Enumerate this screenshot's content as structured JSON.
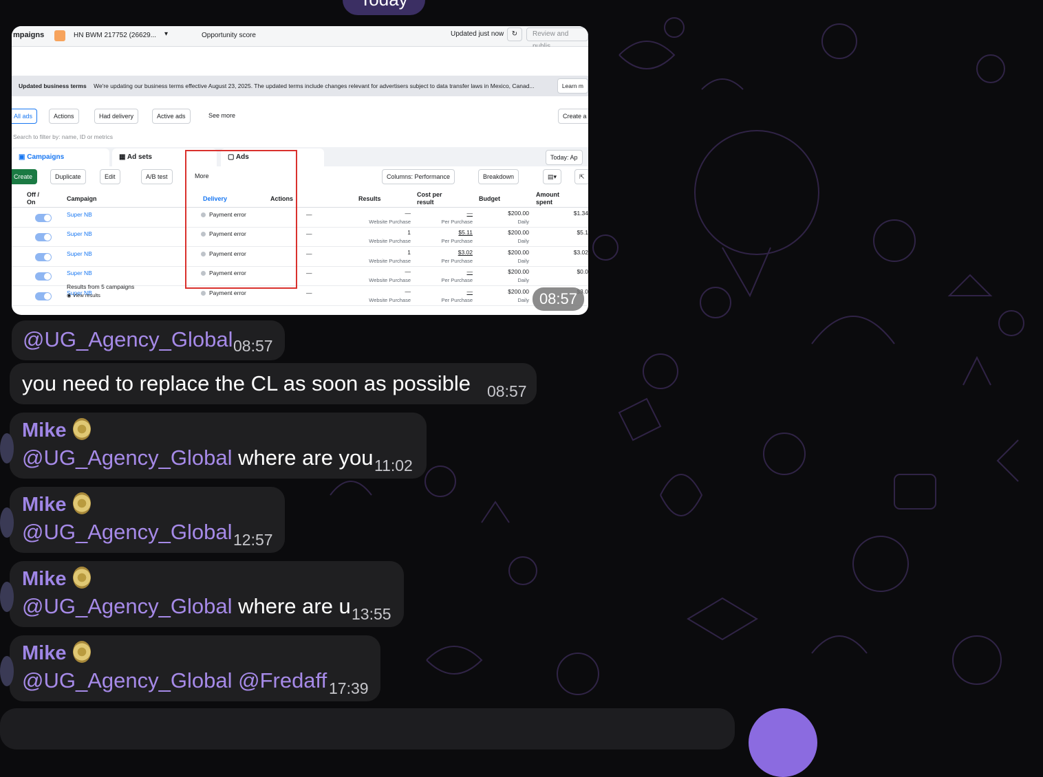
{
  "day_separator": "Today",
  "screenshot": {
    "top_bar": {
      "title_fragment": "mpaigns",
      "account": "HN BWM 217752 (26629...",
      "opportunity": "Opportunity score",
      "updated": "Updated just now",
      "review": "Review and publis"
    },
    "banner": {
      "label": "Updated business terms",
      "text": "We're updating our business terms effective August 23, 2025. The updated terms include changes relevant for advertisers subject to data transfer laws in Mexico, Canad...",
      "learn": "Learn m"
    },
    "filter_tabs": [
      "All ads",
      "Actions",
      "Had delivery",
      "Active ads",
      "See more"
    ],
    "create_all": "Create a",
    "search_placeholder": "Search to filter by: name, ID or metrics",
    "levels": [
      "Campaigns",
      "Ad sets",
      "Ads"
    ],
    "today_label": "Today: Ap",
    "toolbar": {
      "create": "Create",
      "duplicate": "Duplicate",
      "edit": "Edit",
      "ab_test": "A/B test",
      "more": "More",
      "columns": "Columns: Performance",
      "breakdown": "Breakdown"
    },
    "headers": {
      "off_on": "Off / On",
      "campaign": "Campaign",
      "delivery": "Delivery",
      "actions": "Actions",
      "results": "Results",
      "cost_per_result": "Cost per result",
      "budget": "Budget",
      "amount_spent": "Amount spent"
    },
    "rows": [
      {
        "campaign": "Super NB",
        "delivery": "Payment error",
        "dash": "—",
        "result": "—",
        "result_label": "Website Purchase",
        "cpr": "—",
        "cpr_label": "Per Purchase",
        "budget": "$200.00",
        "budget_label": "Daily",
        "spent": "$1.34"
      },
      {
        "campaign": "Super NB",
        "delivery": "Payment error",
        "dash": "—",
        "result": "1",
        "result_label": "Website Purchase",
        "cpr": "$5.11",
        "cpr_label": "Per Purchase",
        "budget": "$200.00",
        "budget_label": "Daily",
        "spent": "$5.1"
      },
      {
        "campaign": "Super NB",
        "delivery": "Payment error",
        "dash": "—",
        "result": "1",
        "result_label": "Website Purchase",
        "cpr": "$3.02",
        "cpr_label": "Per Purchase",
        "budget": "$200.00",
        "budget_label": "Daily",
        "spent": "$3.02"
      },
      {
        "campaign": "Super NB",
        "delivery": "Payment error",
        "dash": "—",
        "result": "—",
        "result_label": "Website Purchase",
        "cpr": "—",
        "cpr_label": "Per Purchase",
        "budget": "$200.00",
        "budget_label": "Daily",
        "spent": "$0.0"
      },
      {
        "campaign": "Super NB",
        "delivery": "Payment error",
        "dash": "—",
        "result": "—",
        "result_label": "Website Purchase",
        "cpr": "—",
        "cpr_label": "Per Purchase",
        "budget": "$200.00",
        "budget_label": "Daily",
        "spent": "$3.0"
      }
    ],
    "footer": {
      "results_from": "Results from 5 campaigns",
      "view_results": "View results"
    },
    "time": "08:57"
  },
  "messages": [
    {
      "mention": "@UG_Agency_Global",
      "text": "",
      "time": "08:57"
    },
    {
      "text": "you need to replace the CL as soon as possible",
      "time": "08:57"
    },
    {
      "author": "Mike",
      "mention": "@UG_Agency_Global",
      "text": "where are you",
      "time": "11:02"
    },
    {
      "author": "Mike",
      "mention": "@UG_Agency_Global",
      "text": "",
      "time": "12:57"
    },
    {
      "author": "Mike",
      "mention": "@UG_Agency_Global",
      "text": "where are u",
      "time": "13:55"
    },
    {
      "author": "Mike",
      "mention": "@UG_Agency_Global",
      "mention2": "@Fredaff",
      "time": "17:39"
    }
  ],
  "colors": {
    "bubble": "#1f1f21",
    "mention": "#a68ae8",
    "name": "#9f86e6",
    "accent": "#8b6be0"
  }
}
